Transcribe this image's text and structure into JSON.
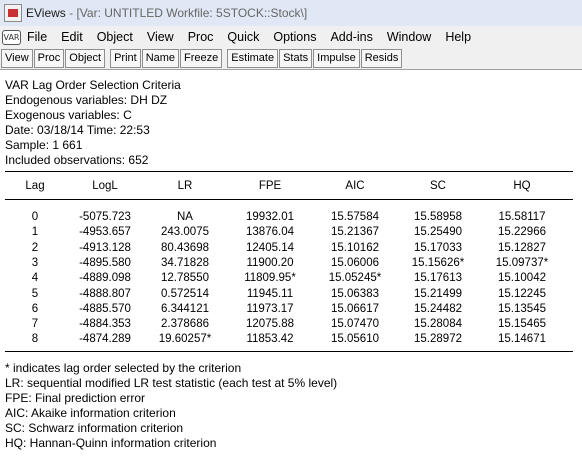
{
  "window": {
    "app_name": "EViews",
    "title_dim": " - [Var: UNTITLED    Workfile: 5STOCK::Stock\\]"
  },
  "menu": {
    "icon_label": "VAR",
    "items": [
      "File",
      "Edit",
      "Object",
      "View",
      "Proc",
      "Quick",
      "Options",
      "Add-ins",
      "Window",
      "Help"
    ]
  },
  "toolbar": {
    "group1": [
      "View",
      "Proc",
      "Object"
    ],
    "group2": [
      "Print",
      "Name",
      "Freeze"
    ],
    "group3": [
      "Estimate",
      "Stats",
      "Impulse",
      "Resids"
    ]
  },
  "output": {
    "header_lines": [
      "VAR Lag Order Selection Criteria",
      "Endogenous variables: DH DZ",
      "Exogenous variables: C",
      "Date: 03/18/14   Time: 22:53",
      "Sample: 1 661",
      "Included observations: 652"
    ],
    "columns": [
      "Lag",
      "LogL",
      "LR",
      "FPE",
      "AIC",
      "SC",
      "HQ"
    ],
    "rows": [
      [
        "0",
        "-5075.723",
        "NA",
        "19932.01",
        "15.57584",
        "15.58958",
        "15.58117"
      ],
      [
        "1",
        "-4953.657",
        "243.0075",
        "13876.04",
        "15.21367",
        "15.25490",
        "15.22966"
      ],
      [
        "2",
        "-4913.128",
        "80.43698",
        "12405.14",
        "15.10162",
        "15.17033",
        "15.12827"
      ],
      [
        "3",
        "-4895.580",
        "34.71828",
        "11900.20",
        "15.06006",
        "15.15626*",
        "15.09737*"
      ],
      [
        "4",
        "-4889.098",
        "12.78550",
        "11809.95*",
        "15.05245*",
        "15.17613",
        "15.10042"
      ],
      [
        "5",
        "-4888.807",
        "0.572514",
        "11945.11",
        "15.06383",
        "15.21499",
        "15.12245"
      ],
      [
        "6",
        "-4885.570",
        "6.344121",
        "11973.17",
        "15.06617",
        "15.24482",
        "15.13545"
      ],
      [
        "7",
        "-4884.353",
        "2.378686",
        "12075.88",
        "15.07470",
        "15.28084",
        "15.15465"
      ],
      [
        "8",
        "-4874.289",
        "19.60257*",
        "11853.42",
        "15.05610",
        "15.28972",
        "15.14671"
      ]
    ],
    "notes": [
      " * indicates lag order selected by the criterion",
      " LR: sequential modified LR test statistic (each test at 5% level)",
      " FPE: Final prediction error",
      " AIC: Akaike information criterion",
      " SC: Schwarz information criterion",
      " HQ: Hannan-Quinn information criterion"
    ]
  }
}
